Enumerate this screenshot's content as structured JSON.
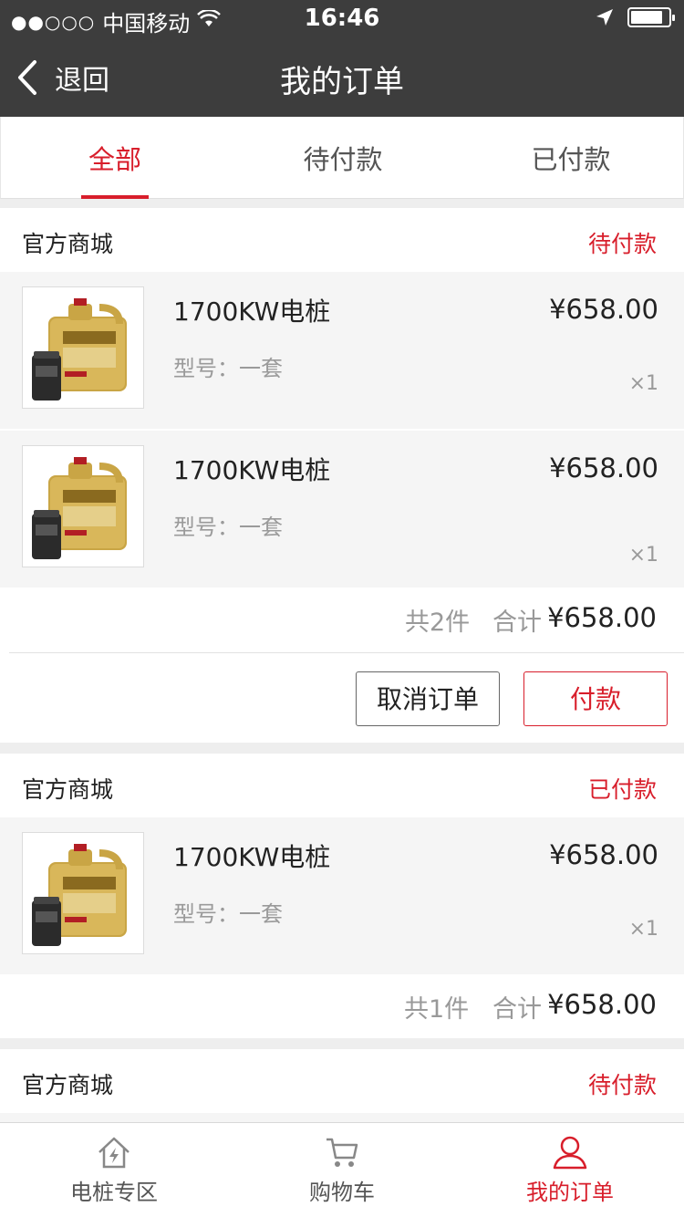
{
  "status_bar": {
    "signal": "●●○○○",
    "carrier": "中国移动",
    "time": "16:46"
  },
  "nav": {
    "back_label": "退回",
    "title": "我的订单"
  },
  "tabs": [
    {
      "label": "全部",
      "active": true
    },
    {
      "label": "待付款",
      "active": false
    },
    {
      "label": "已付款",
      "active": false
    }
  ],
  "orders": [
    {
      "shop": "官方商城",
      "status": "待付款",
      "items": [
        {
          "name": "1700KW电桩",
          "spec": "型号：一套",
          "price": "¥658.00",
          "qty": "×1"
        },
        {
          "name": "1700KW电桩",
          "spec": "型号：一套",
          "price": "¥658.00",
          "qty": "×1"
        }
      ],
      "count_text": "共2件",
      "total_label": "合计",
      "total": "¥658.00",
      "actions": {
        "cancel": "取消订单",
        "pay": "付款"
      }
    },
    {
      "shop": "官方商城",
      "status": "已付款",
      "items": [
        {
          "name": "1700KW电桩",
          "spec": "型号：一套",
          "price": "¥658.00",
          "qty": "×1"
        }
      ],
      "count_text": "共1件",
      "total_label": "合计",
      "total": "¥658.00"
    },
    {
      "shop": "官方商城",
      "status": "待付款"
    }
  ],
  "bottom_tabs": [
    {
      "label": "电桩专区",
      "icon": "home-bolt-icon",
      "active": false
    },
    {
      "label": "购物车",
      "icon": "cart-icon",
      "active": false
    },
    {
      "label": "我的订单",
      "icon": "user-icon",
      "active": true
    }
  ],
  "colors": {
    "accent": "#d81e2b",
    "topbar": "#3d3d3d",
    "item_bg": "#f5f5f5"
  }
}
